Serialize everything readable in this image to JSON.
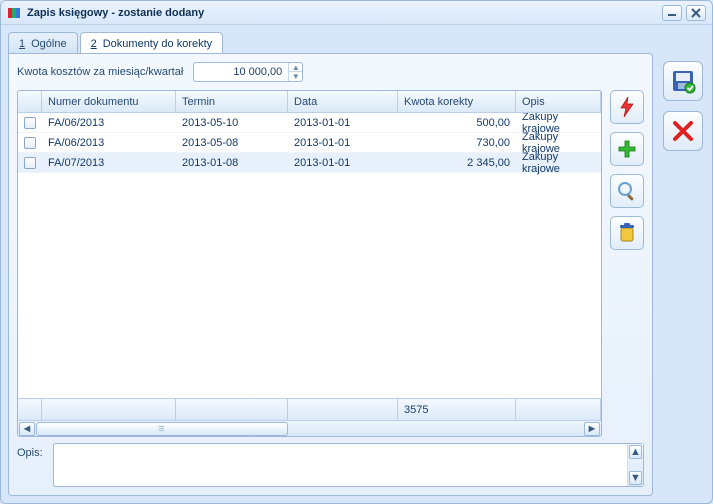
{
  "window": {
    "title": "Zapis księgowy - zostanie dodany"
  },
  "tabs": [
    {
      "num": "1",
      "label": "Ogólne"
    },
    {
      "num": "2",
      "label": "Dokumenty do korekty"
    }
  ],
  "cost": {
    "label": "Kwota kosztów za miesiąc/kwartał",
    "value": "10 000,00"
  },
  "grid": {
    "headers": {
      "doc": "Numer dokumentu",
      "term": "Termin",
      "data": "Data",
      "kw": "Kwota korekty",
      "opis": "Opis"
    },
    "rows": [
      {
        "doc": "FA/06/2013",
        "term": "2013-05-10",
        "data": "2013-01-01",
        "kw": "500,00",
        "opis": "Zakupy krajowe"
      },
      {
        "doc": "FA/06/2013",
        "term": "2013-05-08",
        "data": "2013-01-01",
        "kw": "730,00",
        "opis": "Zakupy krajowe"
      },
      {
        "doc": "FA/07/2013",
        "term": "2013-01-08",
        "data": "2013-01-01",
        "kw": "2 345,00",
        "opis": "Zakupy krajowe"
      }
    ],
    "sum": "3575"
  },
  "opis": {
    "label": "Opis:"
  }
}
